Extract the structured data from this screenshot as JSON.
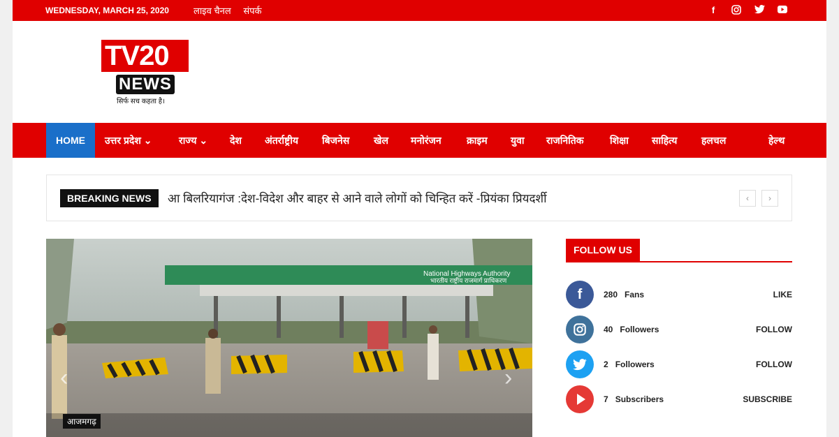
{
  "topbar": {
    "date": "WEDNESDAY, MARCH 25, 2020",
    "links": [
      "लाइव चैनल",
      "संपर्क"
    ],
    "social_icons": [
      "facebook-icon",
      "instagram-icon",
      "twitter-icon",
      "youtube-icon"
    ]
  },
  "logo": {
    "text_tv": "TV20",
    "text_news": "NEWS",
    "tagline": "सिर्फ सच कहता है।"
  },
  "nav": {
    "items": [
      "HOME",
      "उत्तर प्रदेश ⌄",
      "राज्य ⌄",
      "देश",
      "अंतर्राष्ट्रीय",
      "बिजनेस",
      "खेल",
      "मनोरंजन",
      "क्राइम",
      "युवा",
      "राजनितिक",
      "शिक्षा",
      "साहित्य",
      "हलचल",
      "हेल्थ"
    ]
  },
  "breaking": {
    "label": "BREAKING NEWS",
    "headline": "आ बिलरियागंज :देश-विदेश और बाहर से आने वाले लोगों को चिन्हित करें -प्रियंका प्रियदर्शी",
    "prev": "‹",
    "next": "›"
  },
  "hero": {
    "category": "आजमगढ़",
    "sign_text": "National Highways Authority",
    "sign_hindi": "भारतीय राष्ट्रीय राजमार्ग प्राधिकरण"
  },
  "follow": {
    "title": "FOLLOW US",
    "rows": [
      {
        "icon": "f",
        "count": "280",
        "unit": "Fans",
        "action": "LIKE",
        "color": "#3b5998"
      },
      {
        "icon": "◎",
        "count": "40",
        "unit": "Followers",
        "action": "FOLLOW",
        "color": "#3f729b"
      },
      {
        "icon": "✦",
        "count": "2",
        "unit": "Followers",
        "action": "FOLLOW",
        "color": "#1da1f2"
      },
      {
        "icon": "▶",
        "count": "7",
        "unit": "Subscribers",
        "action": "SUBSCRIBE",
        "color": "#e53935"
      }
    ]
  },
  "colors": {
    "brand_red": "#e00000",
    "home_blue": "#1a6fc9"
  }
}
